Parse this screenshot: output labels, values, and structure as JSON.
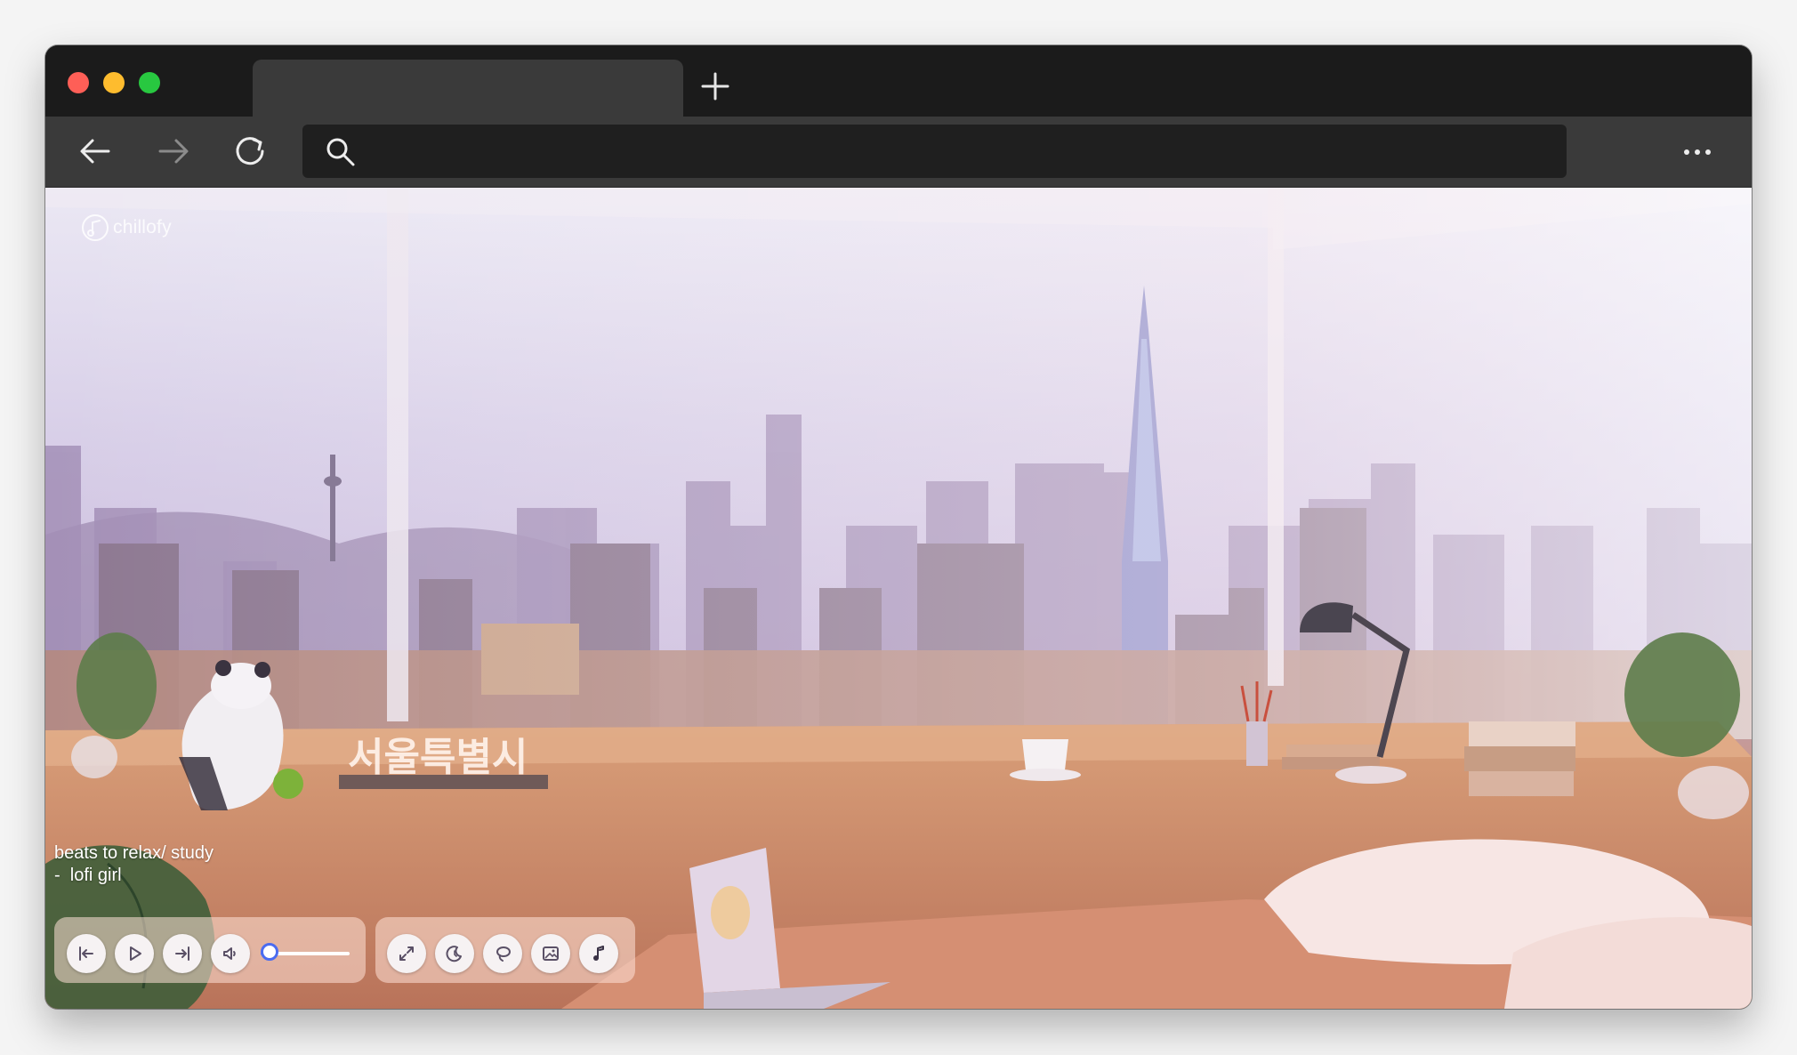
{
  "browser": {
    "tab_title": "",
    "address_value": "",
    "colors": {
      "titlebar": "#1b1b1b",
      "tab": "#3a3a3a",
      "toolbar": "#3a3a3a",
      "address": "#1f1f1f"
    },
    "icons": [
      "back-arrow-icon",
      "forward-arrow-icon",
      "reload-icon",
      "search-icon",
      "more-icon",
      "plus-icon"
    ]
  },
  "app": {
    "logo_text": "chillofy",
    "scene_sign": "서울특별시",
    "track": {
      "line1": "beats to relax/ study",
      "line2": "-  lofi girl"
    },
    "playback_controls": [
      "previous-icon",
      "play-icon",
      "next-icon",
      "volume-icon"
    ],
    "volume": 0.1,
    "feature_controls": [
      "expand-icon",
      "moon-icon",
      "lasso-icon",
      "image-icon",
      "music-note-icon"
    ],
    "accent_color": "#4a6cf0"
  }
}
